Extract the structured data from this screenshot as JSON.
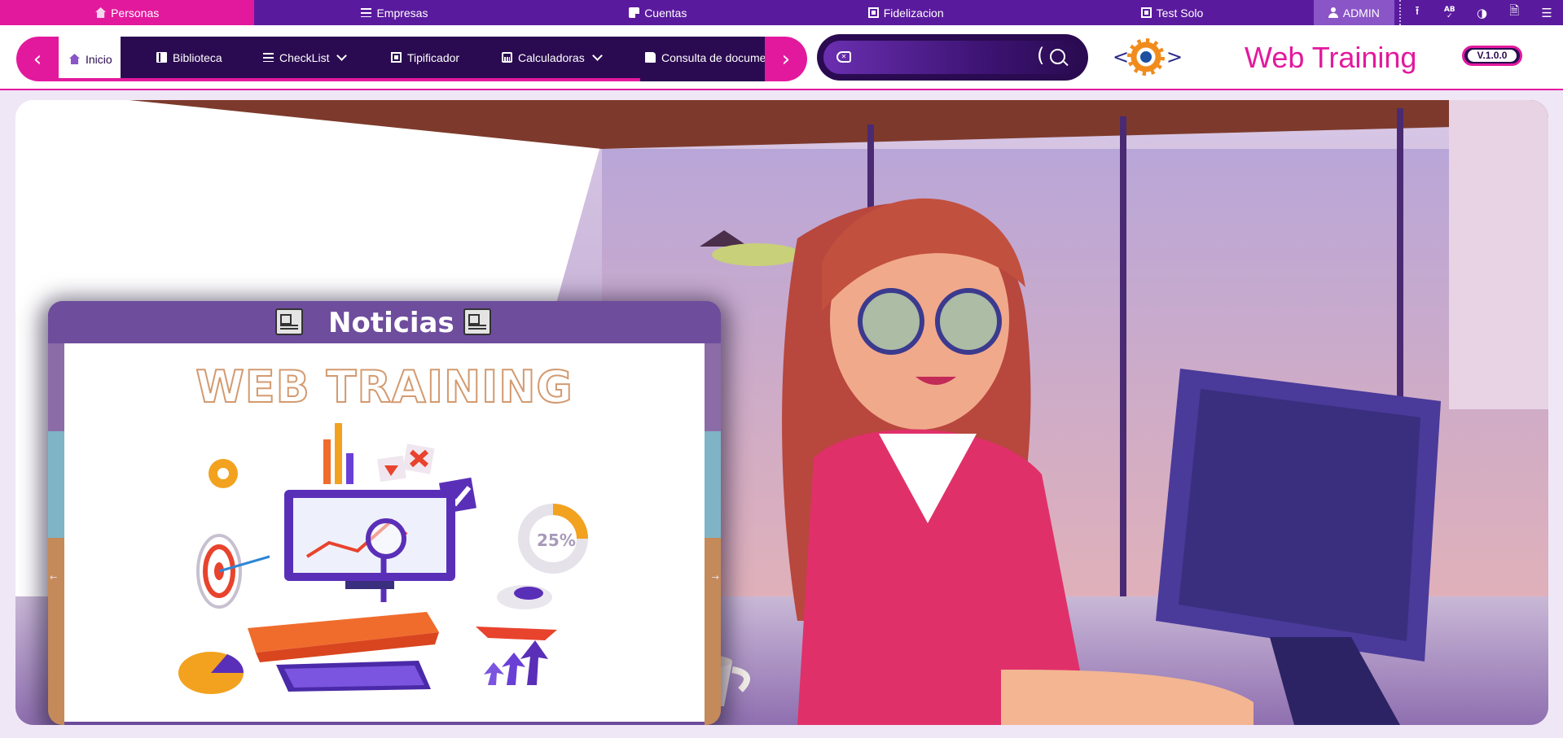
{
  "top_tabs": [
    {
      "label": "Personas",
      "icon": "home-icon"
    },
    {
      "label": "Empresas",
      "icon": "list-icon"
    },
    {
      "label": "Cuentas",
      "icon": "note-icon"
    },
    {
      "label": "Fidelizacion",
      "icon": "card-icon"
    },
    {
      "label": "Test Solo",
      "icon": "card-icon"
    }
  ],
  "user": {
    "label": "ADMIN"
  },
  "tools": [
    "upload-icon",
    "spellcheck-icon",
    "contrast-icon",
    "document-icon",
    "menu-icon"
  ],
  "tools_text": {
    "spellcheck": "AB"
  },
  "menu": [
    {
      "label": "Inicio",
      "icon": "home-icon",
      "dropdown": false
    },
    {
      "label": "Biblioteca",
      "icon": "book-icon",
      "dropdown": false
    },
    {
      "label": "CheckList",
      "icon": "checklist-icon",
      "dropdown": true
    },
    {
      "label": "Tipificador",
      "icon": "card-icon",
      "dropdown": false
    },
    {
      "label": "Calculadoras",
      "icon": "calculator-icon",
      "dropdown": true
    },
    {
      "label": "Consulta de docume",
      "icon": "document-icon",
      "dropdown": false
    }
  ],
  "search": {
    "placeholder": "",
    "value": "",
    "bracket": "("
  },
  "logo": {
    "left": "<",
    "right": ">"
  },
  "brand": {
    "title": "Web Training",
    "version": "V.1.0.0"
  },
  "news": {
    "title": "Noticias",
    "headline": "WEB TRAINING",
    "badge": "25%"
  },
  "colors": {
    "accent": "#e3199d",
    "topbar": "#5a1a9e",
    "menu": "#2a0b51",
    "news_header": "#6e4d9d"
  }
}
